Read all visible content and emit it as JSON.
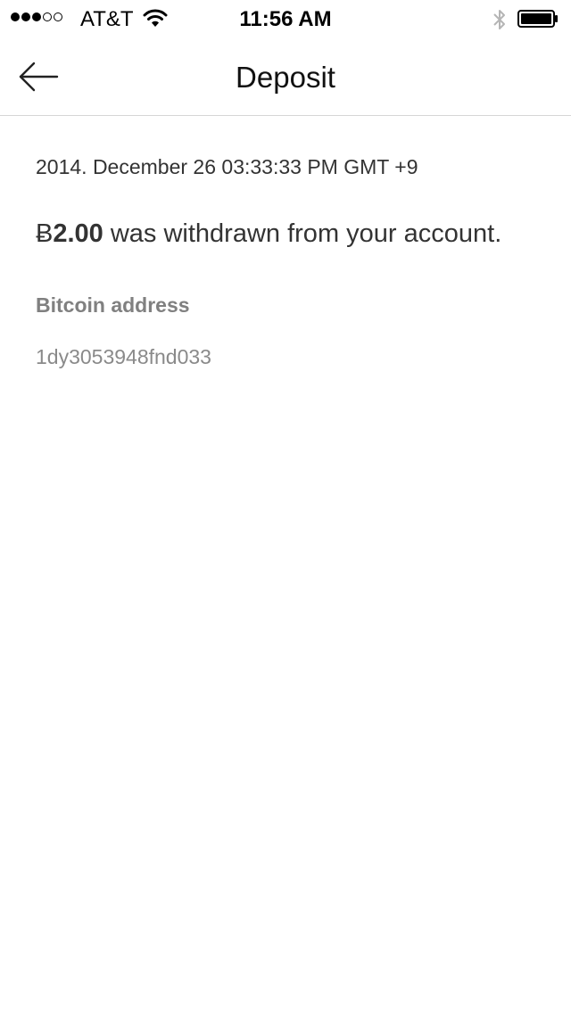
{
  "status_bar": {
    "signal_bars_full": 3,
    "signal_bars_total": 5,
    "carrier": "AT&T",
    "time": "11:56 AM",
    "wifi_icon": "wifi-icon",
    "bluetooth_icon": "bluetooth-icon",
    "battery_icon": "battery-icon"
  },
  "nav": {
    "back_icon": "arrow-left-icon",
    "title": "Deposit"
  },
  "transaction": {
    "datetime": "2014. December 26 03:33:33 PM GMT +9",
    "currency_symbol": "Ƀ",
    "amount": "2.00",
    "message_suffix": " was withdrawn from your account.",
    "address_label": "Bitcoin address",
    "address_value": "1dy3053948fnd033"
  },
  "colors": {
    "text_primary": "#333333",
    "text_secondary": "#808080",
    "divider": "#d6d6d6",
    "background": "#ffffff"
  }
}
